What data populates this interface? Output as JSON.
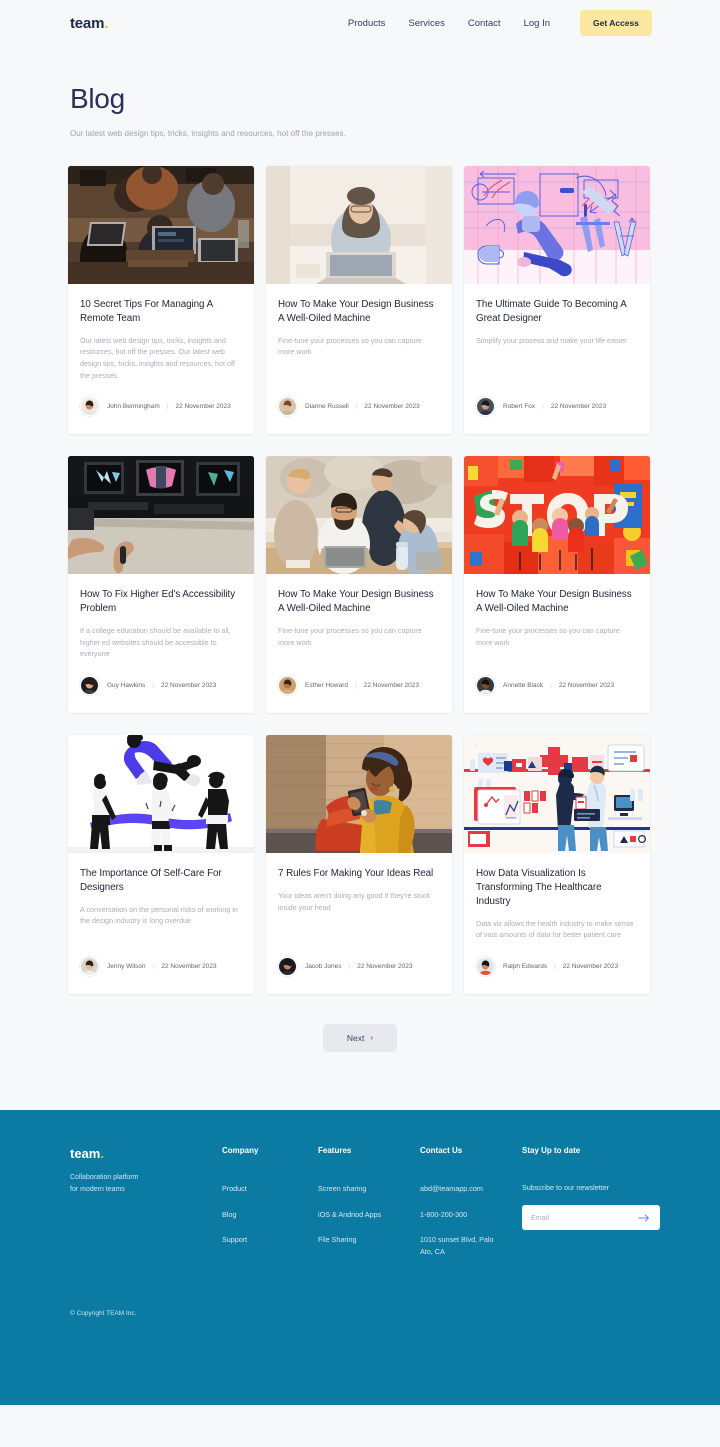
{
  "header": {
    "logo": "team",
    "logo_dot": ".",
    "nav": [
      {
        "label": "Products"
      },
      {
        "label": "Services"
      },
      {
        "label": "Contact"
      },
      {
        "label": "Log In"
      }
    ],
    "cta_label": "Get Access"
  },
  "hero": {
    "title": "Blog",
    "subtitle": "Our latest web design tips, tricks, insights and resources, hot off the presses."
  },
  "posts": [
    {
      "title": "10 Secret Tips For Managing A Remote Team",
      "excerpt": "Our latest web design tips, tricks, insights and resources, hot off the presses. Our latest web design tips, tricks, insights and resources, hot off the presses.",
      "author": "John Bermingham",
      "date": "22 November 2023",
      "image": "photo-team-laptops-cafe"
    },
    {
      "title": "How To Make Your Design Business A Well-Oiled Machine",
      "excerpt": "Fine-tune your processes so you can capture more work",
      "author": "Dianne Russell",
      "date": "22 November 2023",
      "image": "photo-woman-at-laptop"
    },
    {
      "title": "The Ultimate Guide To Becoming A Great Designer",
      "excerpt": "Simplify your process and make your life easier",
      "author": "Robert Fox",
      "date": "22 November 2023",
      "image": "illustration-pink-designer-easel"
    },
    {
      "title": "How To Fix Higher Ed's Accessibility Problem",
      "excerpt": "If a college education should be available to all, higher ed websites should be accessible to everyone",
      "author": "Guy Hawkins",
      "date": "22 November 2023",
      "image": "photo-monitors-hands-dark"
    },
    {
      "title": "How To Make Your Design Business A Well-Oiled Machine",
      "excerpt": "Fine-tune your processes so you can capture more work",
      "author": "Esther Howard",
      "date": "22 November 2023",
      "image": "photo-team-around-laptop"
    },
    {
      "title": "How To Make Your Design Business A Well-Oiled Machine",
      "excerpt": "Fine-tune your processes so you can capture more work",
      "author": "Annette Black",
      "date": "22 November 2023",
      "image": "artwork-stop-collage-red"
    },
    {
      "title": "The Importance Of Self-Care For Designers",
      "excerpt": "A conversation on the personal risks of working in the design industry is long overdue",
      "author": "Jenny Wilson",
      "date": "22 November 2023",
      "image": "illustration-trampoline-people"
    },
    {
      "title": "7 Rules For Making Your Ideas Real",
      "excerpt": "Your ideas aren't doing any good if they're stuck inside your head",
      "author": "Jacob Jones",
      "date": "22 November 2023",
      "image": "photo-woman-phone-sunset"
    },
    {
      "title": "How Data Visualization Is Transforming The Healthcare Industry",
      "excerpt": "Data viz allows the health industry to make sense of vast amounts of data for better patient care",
      "author": "Ralph Edwards",
      "date": "22 November 2023",
      "image": "illustration-healthcare-pharmacy"
    }
  ],
  "pager": {
    "next_label": "Next",
    "next_chevron": "›"
  },
  "footer": {
    "logo": "team",
    "logo_dot": ".",
    "tagline_line1": "Collaboration platform",
    "tagline_line2": "for modern teams",
    "columns": [
      {
        "heading": "Company",
        "links": [
          "Product",
          "Blog",
          "Support"
        ]
      },
      {
        "heading": "Features",
        "links": [
          "Screen sharing",
          "iOS & Andriod Apps",
          "File Sharing"
        ]
      }
    ],
    "contact": {
      "heading": "Contact Us",
      "email": "abd@teamapp.com",
      "phone": "1-800-200-300",
      "address_line1": "1010 sunset Blvd, Palo",
      "address_line2": "Ato, CA"
    },
    "newsletter": {
      "heading": "Stay Up to date",
      "label": "Subscribe to our newsletter",
      "placeholder": "Email",
      "value": ""
    },
    "copyright": "© Copyright TEAM Inc."
  },
  "colors": {
    "page_bg": "#f7f8fa",
    "accent_yellow": "#fbe6a2",
    "footer_bg": "#0b7ba3",
    "title_navy": "#28325a"
  }
}
